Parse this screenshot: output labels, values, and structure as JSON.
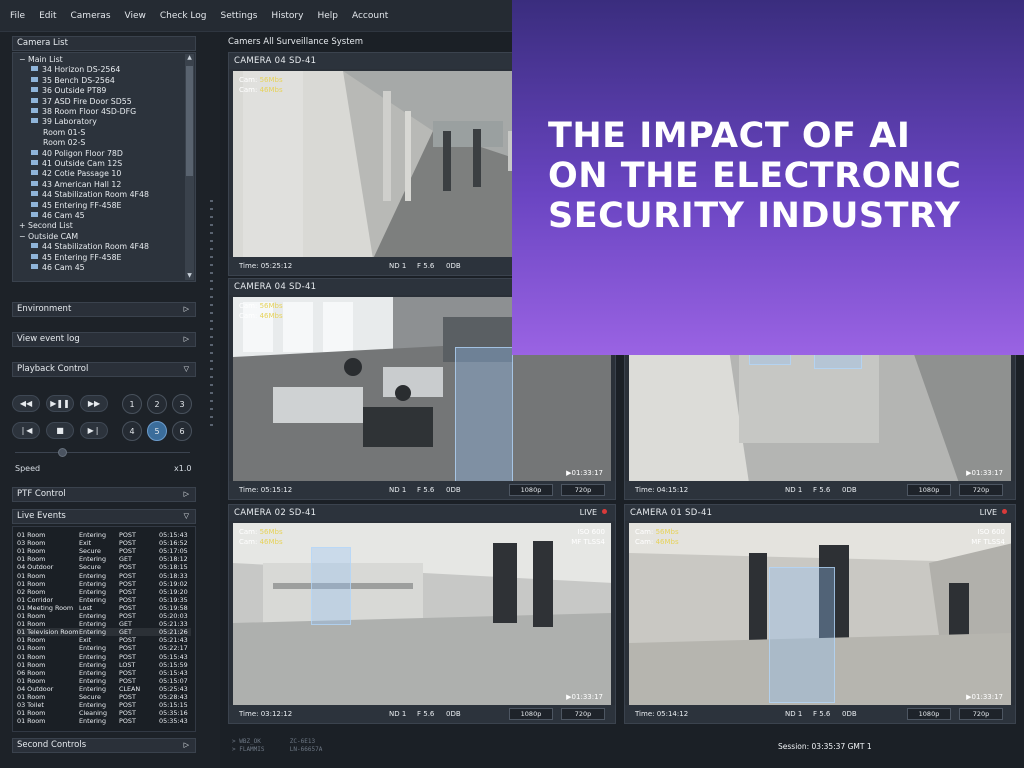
{
  "menu": [
    "File",
    "Edit",
    "Cameras",
    "View",
    "Check Log",
    "Settings",
    "History",
    "Help",
    "Account"
  ],
  "left_panel": {
    "camera_list_title": "Camera List",
    "tree": [
      {
        "t": "− Main List",
        "indent": 0,
        "kind": "group"
      },
      {
        "t": "34 Horizon DS-2564",
        "indent": 1,
        "kind": "cam"
      },
      {
        "t": "35 Bench DS-2564",
        "indent": 1,
        "kind": "cam"
      },
      {
        "t": "36 Outside PT89",
        "indent": 1,
        "kind": "cam"
      },
      {
        "t": "37 ASD Fire Door SD55",
        "indent": 1,
        "kind": "cam"
      },
      {
        "t": "38 Room Floor 4SD-DFG",
        "indent": 1,
        "kind": "cam"
      },
      {
        "t": "39 Laboratory",
        "indent": 1,
        "kind": "folder"
      },
      {
        "t": "Room 01-S",
        "indent": 2,
        "kind": "text"
      },
      {
        "t": "Room 02-S",
        "indent": 2,
        "kind": "text"
      },
      {
        "t": "40 Poligon Floor 78D",
        "indent": 1,
        "kind": "cam"
      },
      {
        "t": "41 Outside Cam 12S",
        "indent": 1,
        "kind": "cam"
      },
      {
        "t": "42 Cotie Passage 10",
        "indent": 1,
        "kind": "cam"
      },
      {
        "t": "43 American Hall 12",
        "indent": 1,
        "kind": "cam"
      },
      {
        "t": "44 Stabilization Room 4F48",
        "indent": 1,
        "kind": "cam"
      },
      {
        "t": "45 Entering FF-458E",
        "indent": 1,
        "kind": "cam"
      },
      {
        "t": "46 Cam 45",
        "indent": 1,
        "kind": "cam"
      },
      {
        "t": "+ Second List",
        "indent": 0,
        "kind": "group"
      },
      {
        "t": "− Outside CAM",
        "indent": 0,
        "kind": "group"
      },
      {
        "t": "44 Stabilization Room 4F48",
        "indent": 1,
        "kind": "cam"
      },
      {
        "t": "45 Entering FF-458E",
        "indent": 1,
        "kind": "cam"
      },
      {
        "t": "46 Cam 45",
        "indent": 1,
        "kind": "cam"
      }
    ],
    "environment": "Environment",
    "view_event_log": "View event log",
    "playback_control": "Playback Control",
    "playback_buttons": [
      "◀◀",
      "▶❚❚",
      "▶▶",
      "❘◀",
      "■",
      "▶❘"
    ],
    "channels": [
      "1",
      "2",
      "3",
      "4",
      "5",
      "6"
    ],
    "selected_channel": "5",
    "speed_label": "Speed",
    "speed_value": "x1.0",
    "ptf_control": "PTF Control",
    "live_events": "Live Events",
    "second_controls": "Second Controls",
    "events": [
      [
        "01 Room",
        "Entering",
        "POST",
        "05:15:43"
      ],
      [
        "03 Room",
        "Exit",
        "POST",
        "05:16:52"
      ],
      [
        "01 Room",
        "Secure",
        "POST",
        "05:17:05"
      ],
      [
        "01 Room",
        "Entering",
        "GET",
        "05:18:12"
      ],
      [
        "04 Outdoor",
        "Secure",
        "POST",
        "05:18:15"
      ],
      [
        "01 Room",
        "Entering",
        "POST",
        "05:18:33"
      ],
      [
        "01 Room",
        "Entering",
        "POST",
        "05:19:02"
      ],
      [
        "02 Room",
        "Entering",
        "POST",
        "05:19:20"
      ],
      [
        "01 Corridor",
        "Entering",
        "POST",
        "05:19:35"
      ],
      [
        "01 Meeting Room",
        "Lost",
        "POST",
        "05:19:58"
      ],
      [
        "01 Room",
        "Entering",
        "POST",
        "05:20:03"
      ],
      [
        "01 Room",
        "Entering",
        "GET",
        "05:21:33"
      ],
      [
        "01 Television Room",
        "Entering",
        "GET",
        "05:21:26"
      ],
      [
        "01 Room",
        "Exit",
        "POST",
        "05:21:43"
      ],
      [
        "01 Room",
        "Entering",
        "POST",
        "05:22:17"
      ],
      [
        "01 Room",
        "Entering",
        "POST",
        "05:15:43"
      ],
      [
        "01 Room",
        "Entering",
        "LOST",
        "05:15:59"
      ],
      [
        "06 Room",
        "Entering",
        "POST",
        "05:15:43"
      ],
      [
        "01 Room",
        "Entering",
        "POST",
        "05:15:07"
      ],
      [
        "04 Outdoor",
        "Entering",
        "CLEAN",
        "05:25:43"
      ],
      [
        "01 Room",
        "Secure",
        "POST",
        "05:28:43"
      ],
      [
        "03 Toilet",
        "Entering",
        "POST",
        "05:15:15"
      ],
      [
        "01 Room",
        "Cleaning",
        "POST",
        "05:35:16"
      ],
      [
        "01 Room",
        "Entering",
        "POST",
        "05:35:43"
      ]
    ],
    "highlight_row": 12
  },
  "main": {
    "title": "Camers All Surveillance System",
    "cameras": [
      {
        "name": "CAMERA 04 SD-41",
        "cam1": "56Mbs",
        "cam2": "46Mbs",
        "time": "Time: 05:25:12",
        "nd": "ND 1",
        "f": "F 5.6",
        "db": "0DB",
        "live": "",
        "iso": "",
        "mf": "",
        "rec": "",
        "res1": "",
        "res2": ""
      },
      {
        "name": "CAMERA 04 SD-41",
        "cam1": "56Mbs",
        "cam2": "46Mbs",
        "time": "Time: 05:15:12",
        "nd": "ND 1",
        "f": "F 5.6",
        "db": "0DB",
        "live": "",
        "iso": "",
        "mf": "",
        "rec": "▶01:33:17",
        "res1": "1080p",
        "res2": "720p"
      },
      {
        "name": "",
        "cam1": "",
        "cam2": "",
        "time": "Time: 04:15:12",
        "nd": "ND 1",
        "f": "F 5.6",
        "db": "0DB",
        "live": "",
        "iso": "",
        "mf": "",
        "rec": "▶01:33:17",
        "res1": "1080p",
        "res2": "720p"
      },
      {
        "name": "CAMERA 02 SD-41",
        "cam1": "56Mbs",
        "cam2": "46Mbs",
        "time": "Time: 03:12:12",
        "nd": "ND 1",
        "f": "F 5.6",
        "db": "0DB",
        "live": "LIVE",
        "iso": "ISO 600",
        "mf": "MF TLSS4",
        "rec": "▶01:33:17",
        "res1": "1080p",
        "res2": "720p"
      },
      {
        "name": "CAMERA 01 SD-41",
        "cam1": "56Mbs",
        "cam2": "46Mbs",
        "time": "Time: 05:14:12",
        "nd": "ND 1",
        "f": "F 5.6",
        "db": "0DB",
        "live": "LIVE",
        "iso": "ISO 600",
        "mf": "MF TLSS4",
        "rec": "▶01:33:17",
        "res1": "1080p",
        "res2": "720p"
      }
    ],
    "status_left_1": "> WBZ_OK        ZC-6E13",
    "status_left_2": "> FLAMMIS       LN-66657A",
    "session": "Session: 03:35:37 GMT 1"
  },
  "banner": {
    "headline": "THE IMPACT OF AI ON THE ELECTRONIC SECURITY INDUSTRY",
    "line1": "THE IMPACT OF AI",
    "line2": "ON THE ELECTRONIC",
    "line3": "SECURITY INDUSTRY"
  },
  "colors": {
    "accent": "#3b6d9b",
    "live_dot": "#d93a3a",
    "meta_value": "#e7d35c",
    "banner_top": "#3a2d7e",
    "banner_bottom": "#9a63e3"
  }
}
